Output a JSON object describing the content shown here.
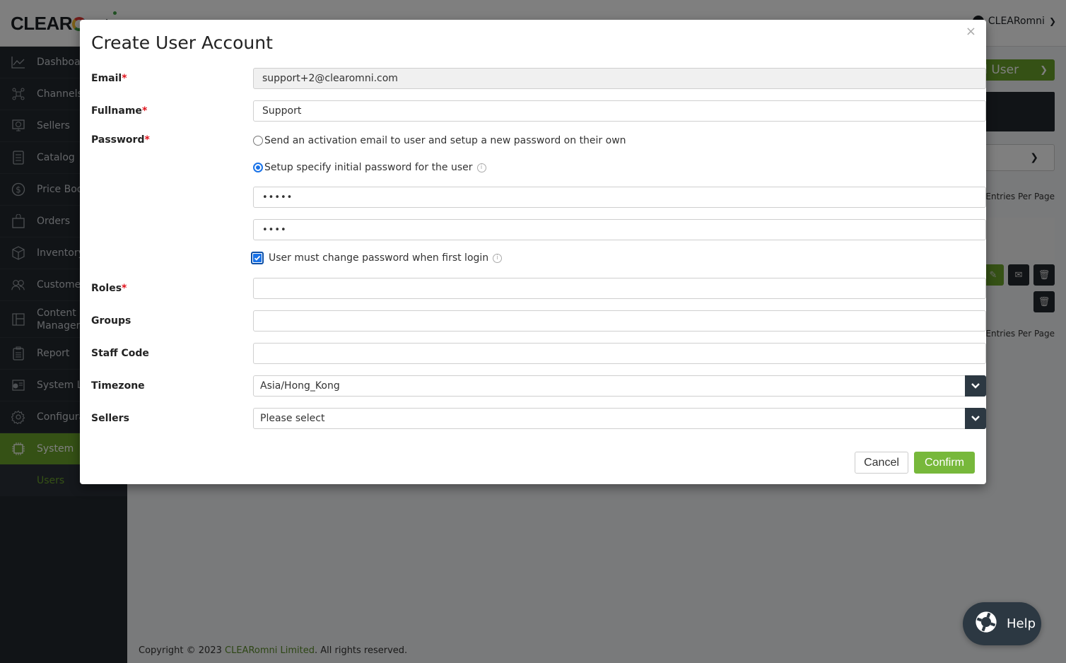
{
  "app": {
    "brand": "CLEARomni",
    "user_menu_label": "CLEARomni"
  },
  "sidebar": {
    "items": [
      {
        "label": "Dashboard",
        "icon": "chart-line-icon"
      },
      {
        "label": "Channels",
        "icon": "network-icon"
      },
      {
        "label": "Sellers",
        "icon": "monitor-globe-icon"
      },
      {
        "label": "Catalog",
        "icon": "document-icon"
      },
      {
        "label": "Price Book",
        "icon": "dollar-circle-icon"
      },
      {
        "label": "Orders",
        "icon": "shopping-bag-icon"
      },
      {
        "label": "Inventory",
        "icon": "box-icon"
      },
      {
        "label": "Customers",
        "icon": "users-icon"
      },
      {
        "label": "Content Manager",
        "icon": "layout-icon"
      },
      {
        "label": "Report",
        "icon": "clipboard-icon"
      },
      {
        "label": "System Log",
        "icon": "log-icon"
      },
      {
        "label": "Configuration",
        "icon": "gear-icon"
      },
      {
        "label": "System",
        "icon": "chip-icon",
        "active": true
      }
    ],
    "sub_items": [
      {
        "label": "Users",
        "active": true
      }
    ]
  },
  "background": {
    "add_user_label": "Add User",
    "entries_per_page_label": "Entries Per Page",
    "footer": {
      "prefix": "Copyright © 2023 ",
      "brand": "CLEARomni Limited",
      "suffix": ". All rights reserved."
    }
  },
  "help_button": {
    "label": "Help"
  },
  "modal": {
    "title": "Create User Account",
    "close_label": "×",
    "fields": {
      "email": {
        "label": "Email",
        "required": "*",
        "value": "support+2@clearomni.com",
        "readonly": true
      },
      "fullname": {
        "label": "Fullname",
        "required": "*",
        "value": "Support"
      },
      "password": {
        "label": "Password",
        "required": "*",
        "options": [
          {
            "label": "Send an activation email to user and setup a new password on their own",
            "selected": false
          },
          {
            "label": "Setup specify initial password for the user",
            "selected": true
          }
        ],
        "password_value": "•••••",
        "confirm_value": "••••",
        "must_change_label": "User must change password when first login",
        "must_change_checked": true
      },
      "roles": {
        "label": "Roles",
        "required": "*",
        "value": ""
      },
      "groups": {
        "label": "Groups",
        "value": ""
      },
      "staff_code": {
        "label": "Staff Code",
        "value": ""
      },
      "timezone": {
        "label": "Timezone",
        "value": "Asia/Hong_Kong"
      },
      "sellers": {
        "label": "Sellers",
        "value": "Please select"
      }
    },
    "cancel_label": "Cancel",
    "confirm_label": "Confirm"
  },
  "colors": {
    "accent_green": "#77b83b",
    "sidebar_bg": "#23282e",
    "required": "#e0121b",
    "select_button": "#2c3842"
  }
}
